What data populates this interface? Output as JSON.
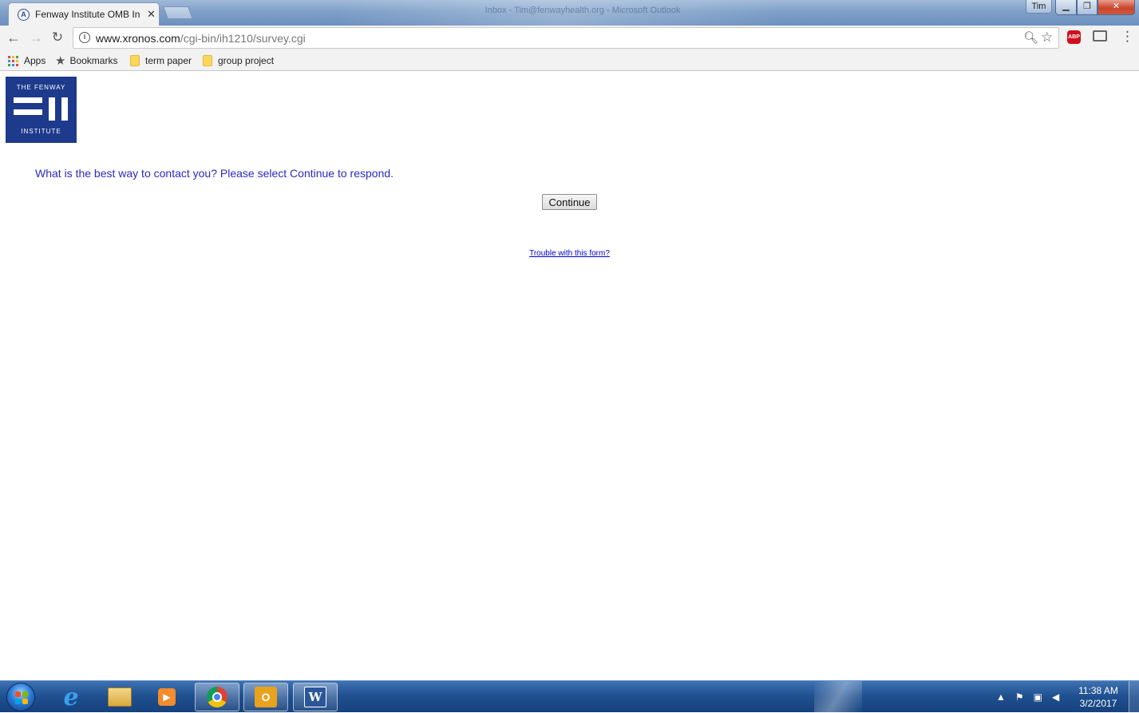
{
  "browser": {
    "window_title": "Inbox - Tim@fenwayhealth.org - Microsoft Outlook",
    "tab": {
      "title": "Fenway Institute OMB In",
      "favicon": "fenway-favicon"
    },
    "user": "Tim",
    "url": {
      "host": "www.xronos.com",
      "path": "/cgi-bin/ih1210/survey.cgi"
    },
    "bookmarks": [
      {
        "label": "Apps",
        "icon": "apps-grid-icon"
      },
      {
        "label": "Bookmarks",
        "icon": "star-icon"
      },
      {
        "label": "term paper",
        "icon": "folder-icon"
      },
      {
        "label": "group project",
        "icon": "folder-icon"
      }
    ],
    "extension_badge": "ABP"
  },
  "page": {
    "logo": {
      "top": "THE FENWAY",
      "bottom": "INSTITUTE",
      "color": "#1e3a8c"
    },
    "question": "What is the best way to contact you? Please select Continue to respond.",
    "continue_label": "Continue",
    "trouble_link": "Trouble with this form?"
  },
  "taskbar": {
    "apps": [
      "internet-explorer",
      "windows-explorer",
      "media-player",
      "google-chrome",
      "microsoft-outlook",
      "microsoft-word"
    ],
    "clock_time": "11:38 AM",
    "clock_date": "3/2/2017"
  },
  "colors": {
    "question_text": "#2a2ac4",
    "link": "#0000cc"
  }
}
